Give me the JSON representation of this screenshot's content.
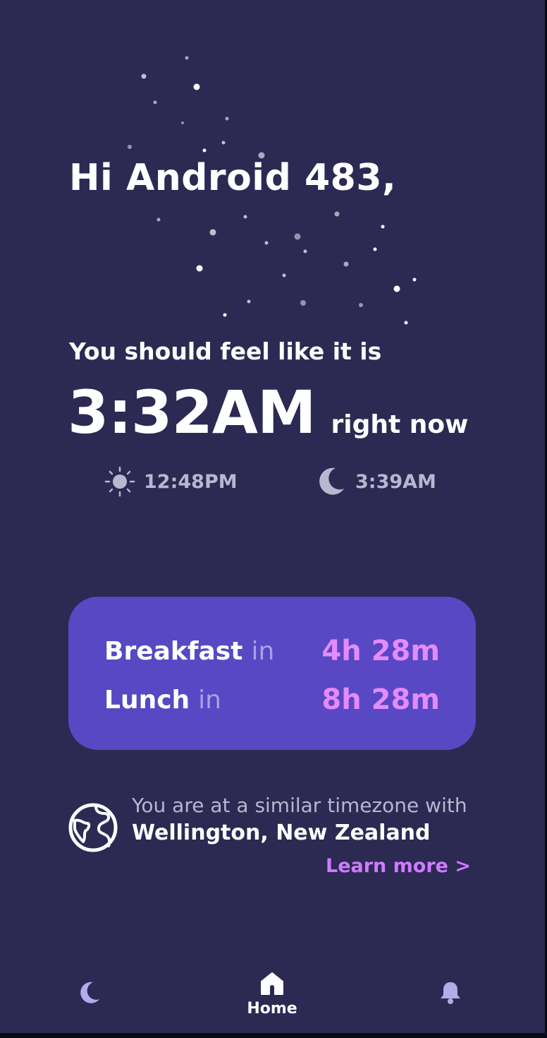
{
  "greeting": "Hi Android 483,",
  "feel": {
    "label": "You should feel like it is",
    "time": "3:32AM",
    "suffix": "right now"
  },
  "sun": {
    "icon": "sun-icon",
    "time": "12:48PM"
  },
  "moon": {
    "icon": "moon-icon",
    "time": "3:39AM"
  },
  "meals": [
    {
      "name": "Breakfast",
      "connector": "in",
      "time": "4h 28m"
    },
    {
      "name": "Lunch",
      "connector": "in",
      "time": "8h 28m"
    }
  ],
  "timezone": {
    "icon": "globe-icon",
    "line1": "You are at a similar timezone with",
    "city": "Wellington, New Zealand",
    "learn_more": "Learn more >"
  },
  "nav": {
    "items": [
      {
        "icon": "moon-icon",
        "label": ""
      },
      {
        "icon": "home-icon",
        "label": "Home",
        "active": true
      },
      {
        "icon": "bell-icon",
        "label": ""
      }
    ]
  },
  "colors": {
    "background": "#2c2953",
    "card": "#5848c4",
    "accent": "#e58aff",
    "link": "#cf7bff",
    "muted": "#b9b6cf"
  }
}
